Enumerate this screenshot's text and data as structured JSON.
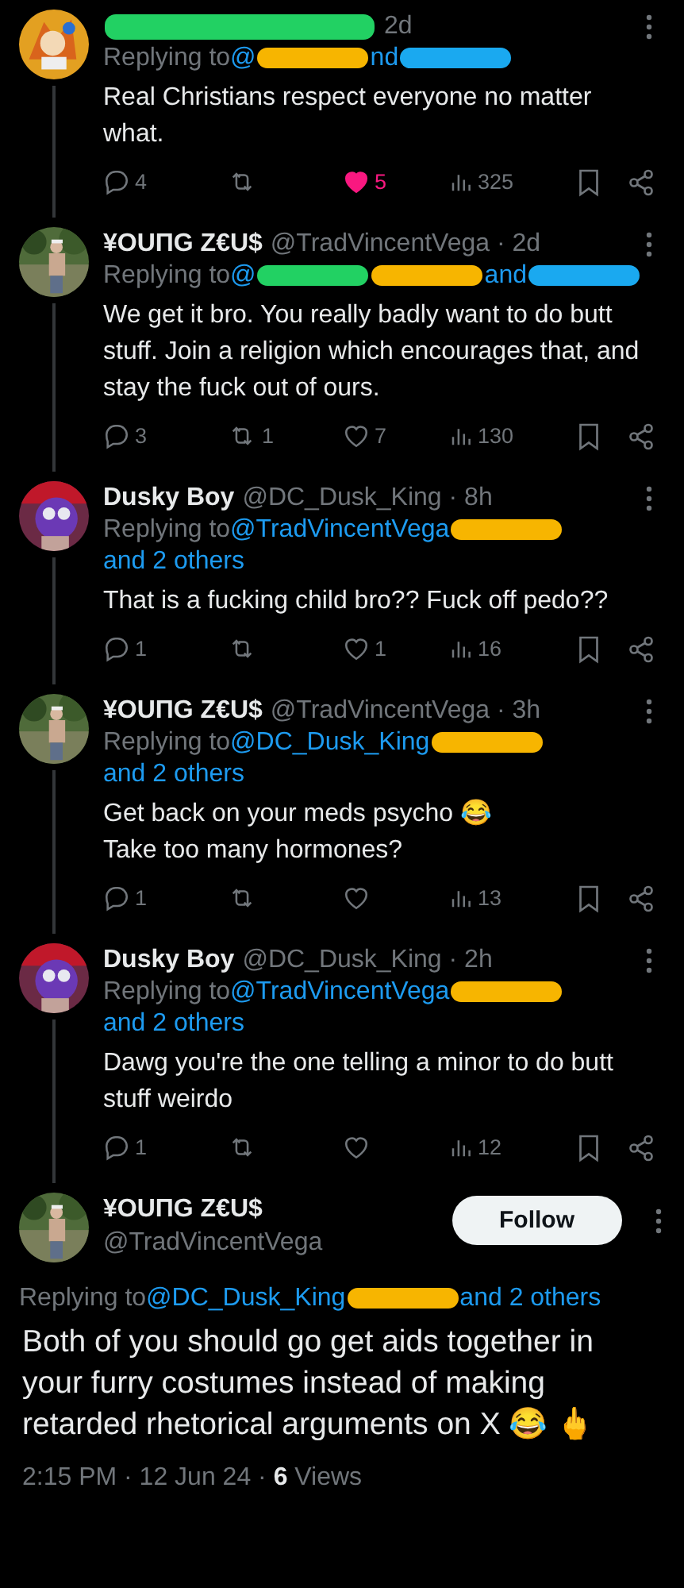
{
  "thread": [
    {
      "author": {
        "name_redaction": {
          "color": "#22d163"
        },
        "handle_tail": "2d"
      },
      "replying": [
        {
          "kind": "text",
          "text": "Replying to"
        },
        {
          "kind": "link",
          "text": "@"
        },
        {
          "kind": "redaction",
          "color": "#f7b500"
        },
        {
          "kind": "link",
          "text": "nd"
        },
        {
          "kind": "redaction",
          "color": "#1aa9f0"
        }
      ],
      "text": "Real Christians respect everyone no matter what.",
      "actions": {
        "replies": "4",
        "reposted": false,
        "likes": "5",
        "liked": true,
        "views": "325"
      }
    },
    {
      "author": {
        "name": "¥OUПG Z€U$",
        "handle": "@TradVincentVega · 2d"
      },
      "replying": [
        {
          "kind": "text",
          "text": "Replying to"
        },
        {
          "kind": "link",
          "text": "@"
        },
        {
          "kind": "redaction",
          "color": "#22d163"
        },
        {
          "kind": "redaction",
          "color": "#f7b500"
        },
        {
          "kind": "link",
          "text": "and"
        },
        {
          "kind": "redaction",
          "color": "#1aa9f0"
        }
      ],
      "text": "We get it bro. You really badly want to do butt stuff. Join a religion which encourages that, and stay the fuck out of ours.",
      "actions": {
        "replies": "3",
        "reposts": "1",
        "reposted": false,
        "likes": "7",
        "liked": false,
        "views": "130"
      }
    },
    {
      "author": {
        "name": "Dusky Boy",
        "handle": "@DC_Dusk_King · 8h"
      },
      "replying": [
        {
          "kind": "text",
          "text": "Replying to"
        },
        {
          "kind": "link",
          "text": "@TradVincentVega"
        },
        {
          "kind": "redaction",
          "color": "#f7b500"
        },
        {
          "kind": "link",
          "text": "and 2 others"
        }
      ],
      "text": "That is a fucking child bro?? Fuck off pedo??",
      "actions": {
        "replies": "1",
        "reposted": false,
        "likes": "1",
        "liked": false,
        "views": "16"
      }
    },
    {
      "author": {
        "name": "¥OUПG Z€U$",
        "handle": "@TradVincentVega · 3h"
      },
      "replying": [
        {
          "kind": "text",
          "text": "Replying to"
        },
        {
          "kind": "link",
          "text": "@DC_Dusk_King"
        },
        {
          "kind": "redaction",
          "color": "#f7b500"
        },
        {
          "kind": "link",
          "text": "and 2 others"
        }
      ],
      "text": "Get back on your meds psycho 😂\nTake too many hormones?",
      "actions": {
        "replies": "1",
        "reposted": false,
        "liked": false,
        "views": "13"
      }
    },
    {
      "author": {
        "name": "Dusky Boy",
        "handle": "@DC_Dusk_King · 2h"
      },
      "replying": [
        {
          "kind": "text",
          "text": "Replying to"
        },
        {
          "kind": "link",
          "text": "@TradVincentVega"
        },
        {
          "kind": "redaction",
          "color": "#f7b500"
        },
        {
          "kind": "link",
          "text": "and 2 others"
        }
      ],
      "text": "Dawg you're the one telling a minor to do butt stuff weirdo",
      "actions": {
        "replies": "1",
        "reposted": false,
        "liked": false,
        "views": "12"
      }
    }
  ],
  "main_post": {
    "author": {
      "name": "¥OUПG Z€U$",
      "handle": "@TradVincentVega"
    },
    "follow_button": "Follow",
    "replying": [
      {
        "kind": "text",
        "text": "Replying to"
      },
      {
        "kind": "link",
        "text": "@DC_Dusk_King"
      },
      {
        "kind": "redaction",
        "color": "#f7b500"
      },
      {
        "kind": "link",
        "text": "and 2 others"
      }
    ],
    "text": "Both of you should go get aids together in your furry costumes instead of making retarded rhetorical arguments on X 😂 🖕",
    "meta": "2:15 PM · 12 Jun 24 · **6** Views"
  }
}
